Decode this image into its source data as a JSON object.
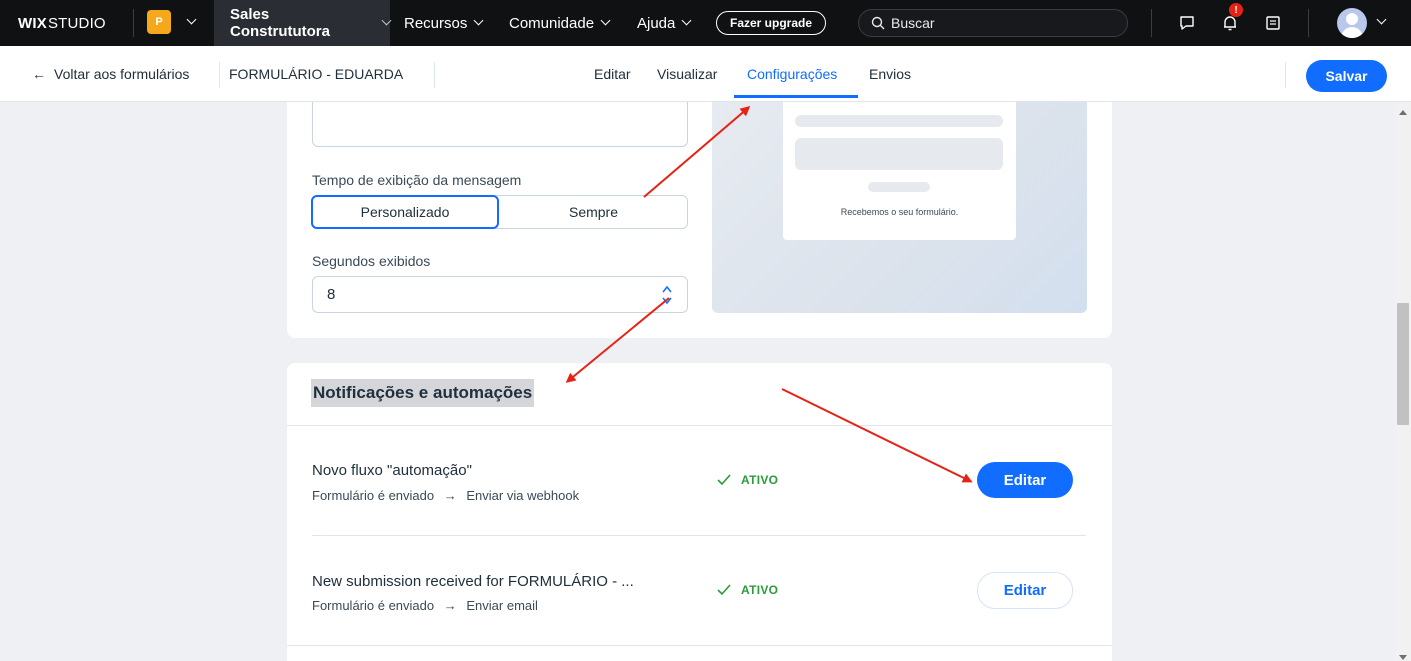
{
  "topbar": {
    "logo_bold": "WIX",
    "logo_rest": "STUDIO",
    "workspace_initial": "P",
    "site_name": "Sales Constrututora",
    "nav": [
      "Recursos",
      "Comunidade",
      "Ajuda"
    ],
    "upgrade_label": "Fazer upgrade",
    "search_placeholder": "Buscar",
    "notification_badge": "!"
  },
  "subheader": {
    "back_label": "Voltar aos formulários",
    "form_name": "FORMULÁRIO - EDUARDA",
    "tabs": [
      "Editar",
      "Visualizar",
      "Configurações",
      "Envios"
    ],
    "active_tab": "Configurações",
    "save_label": "Salvar"
  },
  "message_settings": {
    "display_time_label": "Tempo de exibição da mensagem",
    "options": [
      "Personalizado",
      "Sempre"
    ],
    "selected_option": "Personalizado",
    "seconds_label": "Segundos exibidos",
    "seconds_value": "8",
    "preview_text": "Recebemos o seu formulário."
  },
  "automations": {
    "title": "Notificações e automações",
    "items": [
      {
        "title": "Novo fluxo \"automação\"",
        "trigger": "Formulário é enviado",
        "action": "Enviar via webhook",
        "status": "ATIVO",
        "button": "Editar"
      },
      {
        "title": "New submission received for FORMULÁRIO - ...",
        "trigger": "Formulário é enviado",
        "action": "Enviar email",
        "status": "ATIVO",
        "button": "Editar"
      }
    ]
  },
  "colors": {
    "accent": "#116dff",
    "status_active": "#2d9a3b",
    "annotation_arrow": "#e62214"
  }
}
